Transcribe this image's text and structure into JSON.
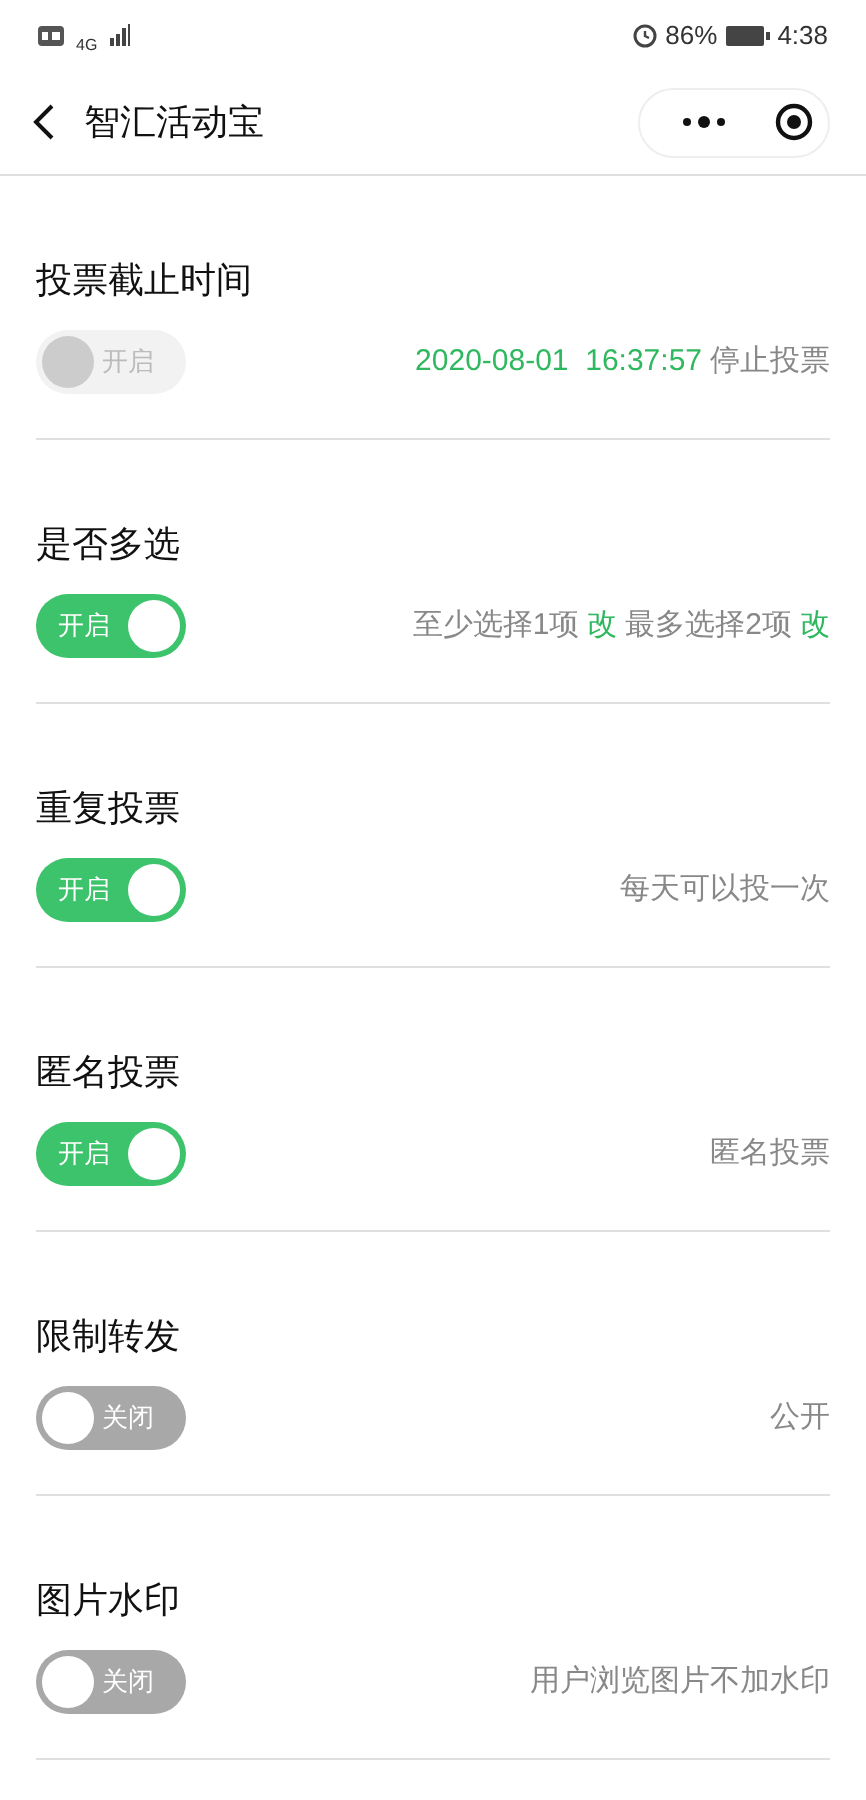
{
  "status_bar": {
    "network": "4G",
    "battery": "86%",
    "time": "4:38"
  },
  "nav": {
    "title": "智汇活动宝"
  },
  "settings": [
    {
      "title": "投票截止时间",
      "toggle": {
        "label": "开启",
        "on": false,
        "disabled": true
      },
      "detail": [
        {
          "kind": "accent",
          "text": "2020-08-01  16:37:57"
        },
        {
          "kind": "text",
          "text": "停止投票"
        }
      ]
    },
    {
      "title": "是否多选",
      "toggle": {
        "label": "开启",
        "on": true,
        "disabled": false
      },
      "detail": [
        {
          "kind": "text",
          "text": "至少选择1项"
        },
        {
          "kind": "link",
          "text": "改"
        },
        {
          "kind": "text",
          "text": "最多选择2项"
        },
        {
          "kind": "link",
          "text": "改"
        }
      ]
    },
    {
      "title": "重复投票",
      "toggle": {
        "label": "开启",
        "on": true,
        "disabled": false
      },
      "detail": [
        {
          "kind": "text",
          "text": "每天可以投一次"
        }
      ]
    },
    {
      "title": "匿名投票",
      "toggle": {
        "label": "开启",
        "on": true,
        "disabled": false
      },
      "detail": [
        {
          "kind": "text",
          "text": "匿名投票"
        }
      ]
    },
    {
      "title": "限制转发",
      "toggle": {
        "label": "关闭",
        "on": false,
        "disabled": false
      },
      "detail": [
        {
          "kind": "text",
          "text": "公开"
        }
      ]
    },
    {
      "title": "图片水印",
      "toggle": {
        "label": "关闭",
        "on": false,
        "disabled": false
      },
      "detail": [
        {
          "kind": "text",
          "text": "用户浏览图片不加水印"
        }
      ]
    }
  ]
}
